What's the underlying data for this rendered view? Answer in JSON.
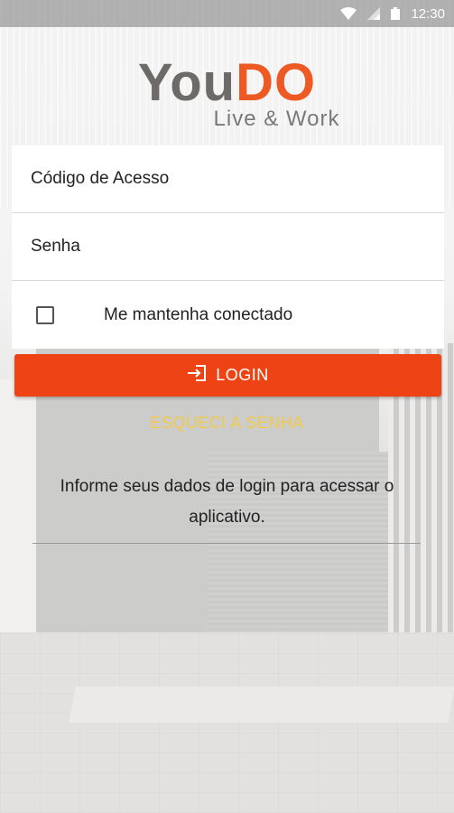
{
  "status_bar": {
    "time": "12:30",
    "icons": [
      "wifi-icon",
      "signal-icon",
      "battery-icon"
    ]
  },
  "logo": {
    "word_part1": "You",
    "word_part2": "DO",
    "tagline": "Live & Work"
  },
  "form": {
    "access_code_placeholder": "Código de Acesso",
    "password_placeholder": "Senha",
    "remember_label": "Me mantenha conectado",
    "remember_checked": false
  },
  "actions": {
    "login_label": "LOGIN",
    "login_icon": "login-icon",
    "forgot_label": "ESQUECI A SENHA"
  },
  "info": {
    "message": "Informe seus dados de login para acessar o aplicativo."
  },
  "colors": {
    "accent": "#ee4314",
    "logo_gray": "#6c6b69",
    "logo_orange": "#ee5a24",
    "link": "#f2c94c"
  }
}
